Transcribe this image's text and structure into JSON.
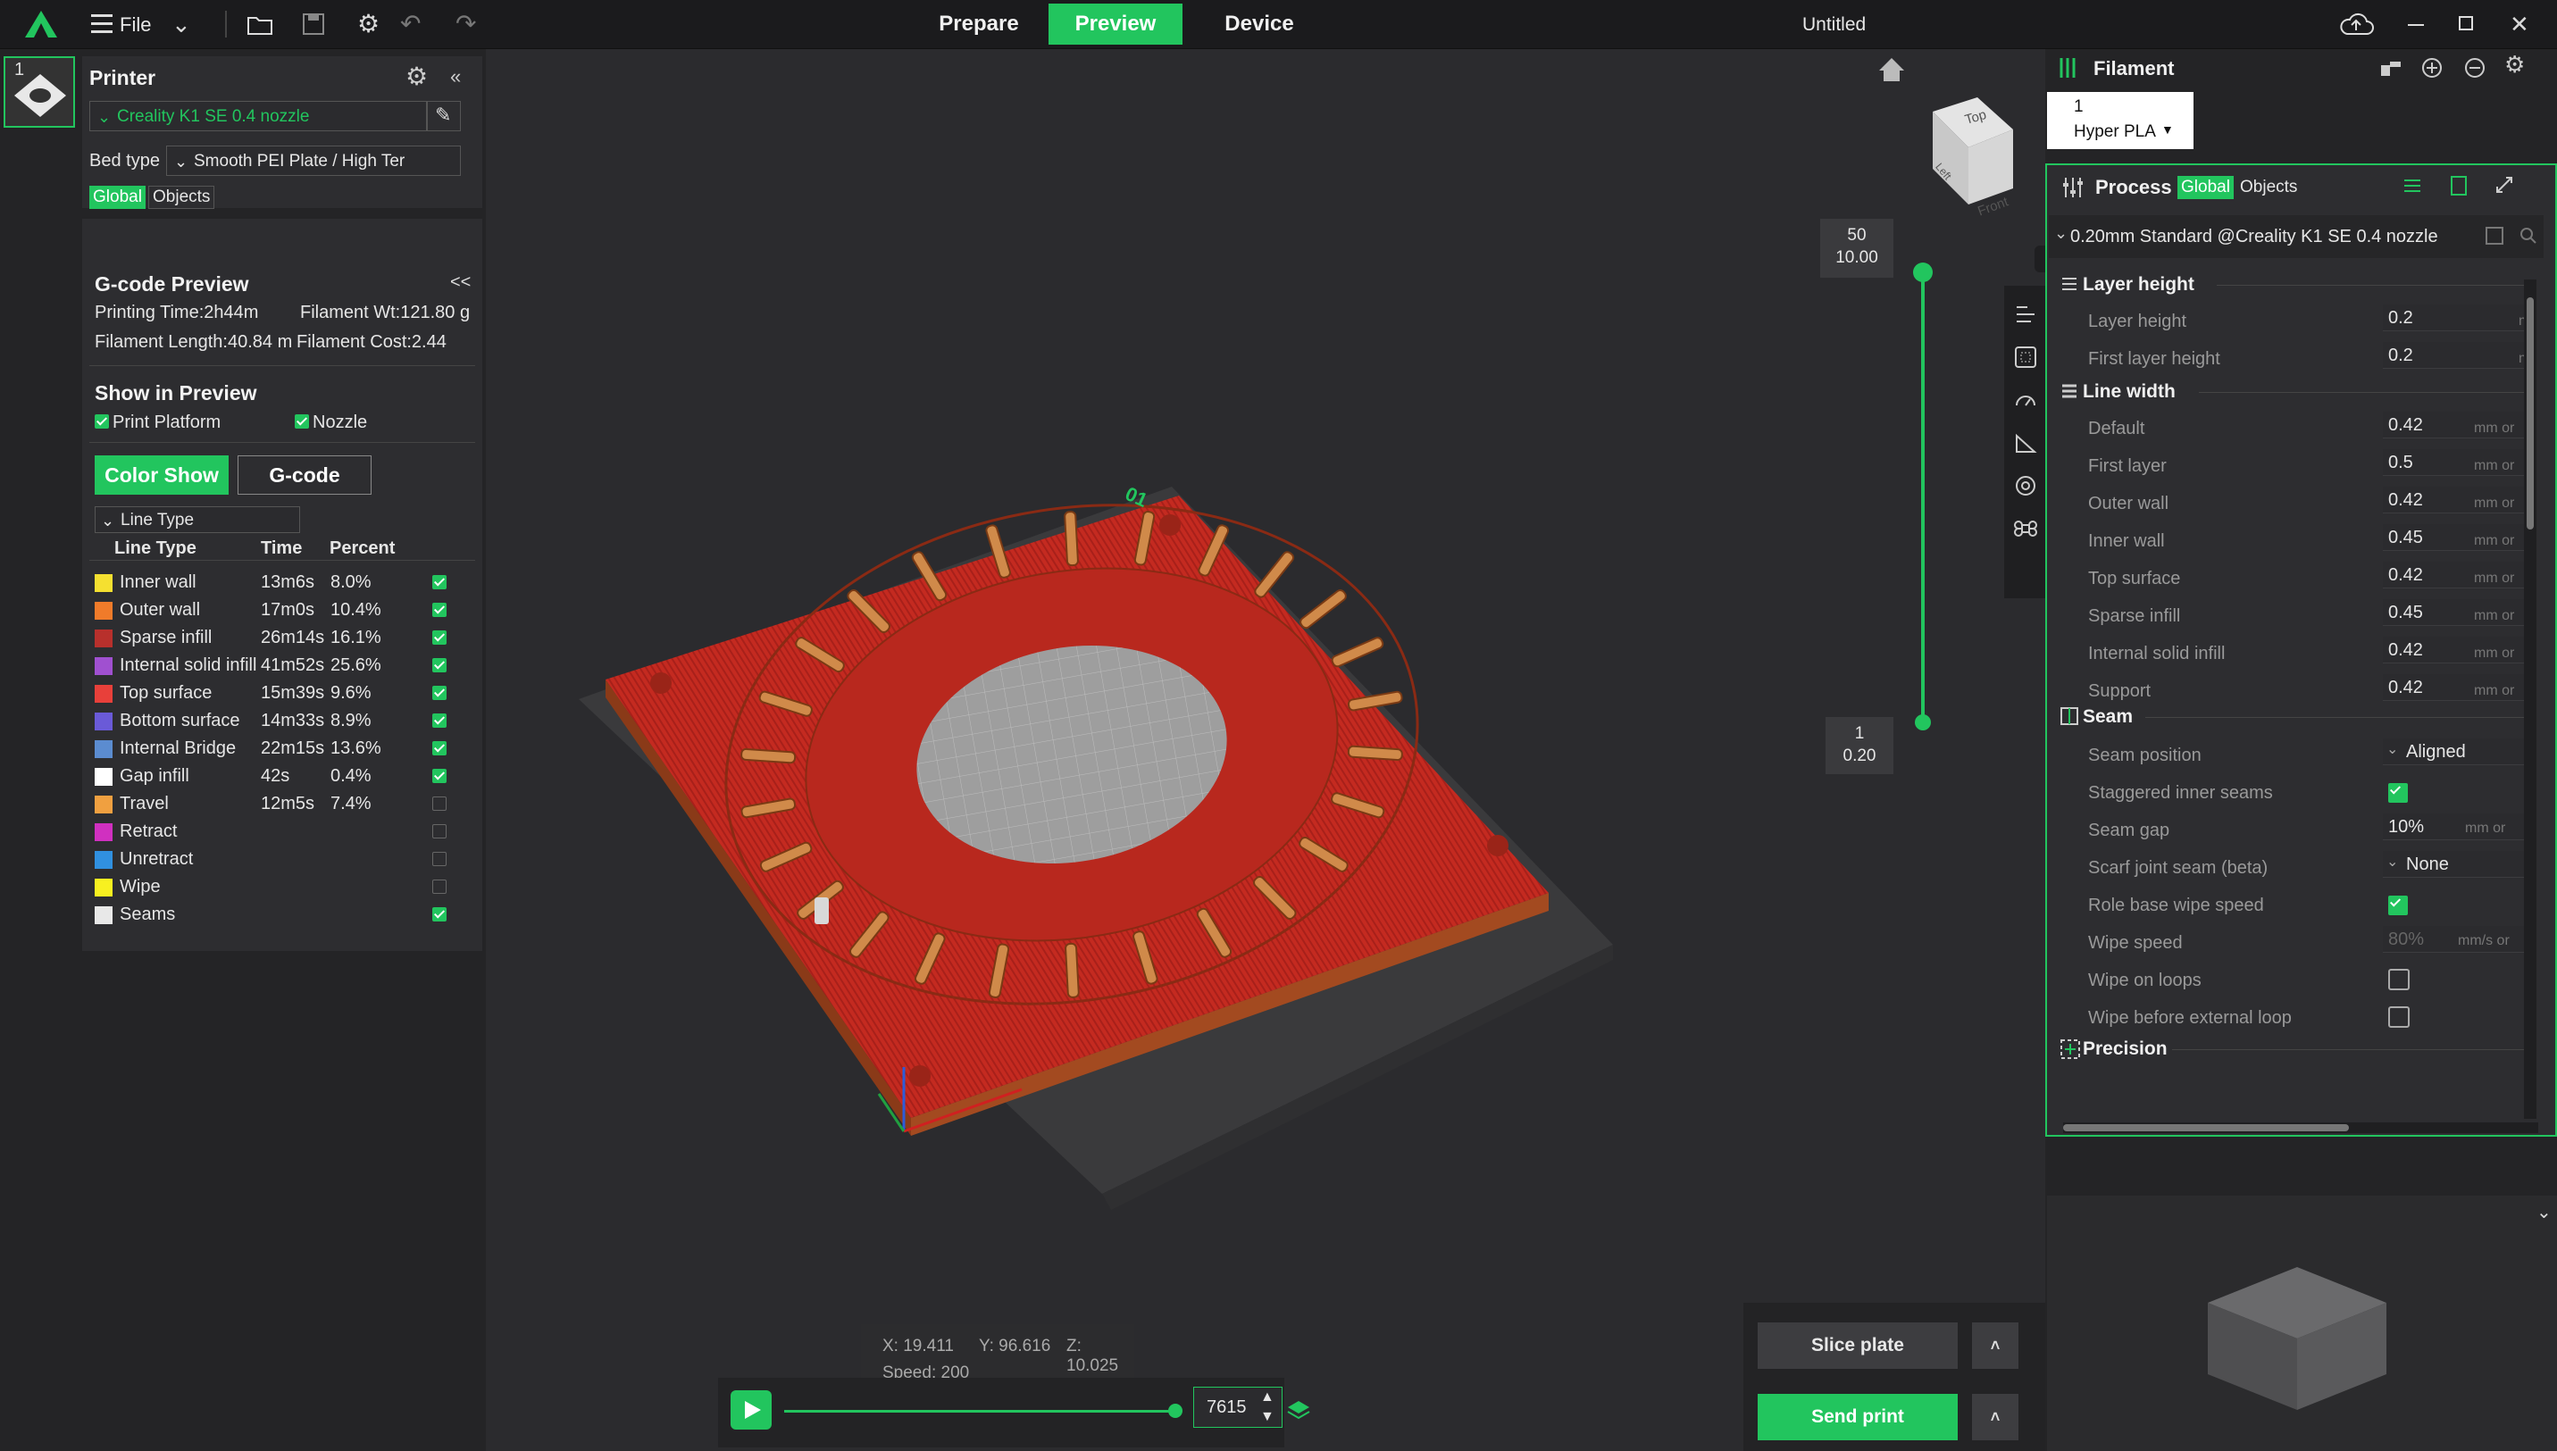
{
  "topbar": {
    "file_label": "File",
    "tabs": [
      {
        "label": "Prepare"
      },
      {
        "label": "Preview"
      },
      {
        "label": "Device"
      }
    ],
    "title": "Untitled"
  },
  "printer": {
    "header": "Printer",
    "printer_name": "Creality K1 SE 0.4 nozzle",
    "bed_type_label": "Bed type",
    "bed_type_value": "Smooth PEI Plate / High Ter",
    "global_label": "Global",
    "objects_label": "Objects",
    "plate_number": "1"
  },
  "gcode": {
    "header": "G-code Preview",
    "collapse": "<<",
    "printing_time": "Printing Time:2h44m",
    "filament_wt": "Filament Wt:121.80 g",
    "filament_length": "Filament Length:40.84 m",
    "filament_cost": "Filament Cost:2.44"
  },
  "show_preview": {
    "header": "Show in Preview",
    "print_platform": "Print Platform",
    "nozzle": "Nozzle",
    "color_show": "Color Show",
    "gcode_btn": "G-code",
    "line_type_select": "Line Type",
    "columns": [
      "Line Type",
      "Time",
      "Percent"
    ],
    "rows": [
      {
        "name": "Inner wall",
        "time": "13m6s",
        "percent": "8.0%",
        "color": "#f5e030",
        "checked": true
      },
      {
        "name": "Outer wall",
        "time": "17m0s",
        "percent": "10.4%",
        "color": "#f07b2a",
        "checked": true
      },
      {
        "name": "Sparse infill",
        "time": "26m14s",
        "percent": "16.1%",
        "color": "#b8302c",
        "checked": true
      },
      {
        "name": "Internal solid infill",
        "time": "41m52s",
        "percent": "25.6%",
        "color": "#a050d0",
        "checked": true
      },
      {
        "name": "Top surface",
        "time": "15m39s",
        "percent": "9.6%",
        "color": "#e8403a",
        "checked": true
      },
      {
        "name": "Bottom surface",
        "time": "14m33s",
        "percent": "8.9%",
        "color": "#6a5ad8",
        "checked": true
      },
      {
        "name": "Internal Bridge",
        "time": "22m15s",
        "percent": "13.6%",
        "color": "#5b8cd0",
        "checked": true
      },
      {
        "name": "Gap infill",
        "time": "42s",
        "percent": "0.4%",
        "color": "#ffffff",
        "checked": true
      },
      {
        "name": "Travel",
        "time": "12m5s",
        "percent": "7.4%",
        "color": "#f0a040",
        "checked": false
      },
      {
        "name": "Retract",
        "time": "",
        "percent": "",
        "color": "#d030c0",
        "checked": false
      },
      {
        "name": "Unretract",
        "time": "",
        "percent": "",
        "color": "#3090e0",
        "checked": false
      },
      {
        "name": "Wipe",
        "time": "",
        "percent": "",
        "color": "#f8f020",
        "checked": false
      },
      {
        "name": "Seams",
        "time": "",
        "percent": "",
        "color": "#e8e8e8",
        "checked": true
      }
    ]
  },
  "viewport": {
    "plate_label": "01",
    "cube_top": "Top",
    "cube_front": "Front",
    "cube_left": "Left",
    "slider_top_layer": "50",
    "slider_top_height": "10.00",
    "slider_bottom_layer": "1",
    "slider_bottom_height": "0.20",
    "coords_x": "X: 19.411",
    "coords_y": "Y: 96.616",
    "coords_z": "Z: 10.025",
    "speed": "Speed: 200",
    "move_value": "7615",
    "slice_plate": "Slice plate",
    "send_print": "Send print"
  },
  "filament": {
    "header": "Filament",
    "slot_number": "1",
    "slot_name": "Hyper PLA"
  },
  "process": {
    "header": "Process",
    "global_label": "Global",
    "objects_label": "Objects",
    "preset": "0.20mm Standard @Creality K1 SE 0.4 nozzle",
    "sections": {
      "layer_height": "Layer height",
      "line_width": "Line width",
      "seam": "Seam",
      "precision": "Precision"
    },
    "layer_height_rows": [
      {
        "label": "Layer height",
        "value": "0.2",
        "unit": "m"
      },
      {
        "label": "First layer height",
        "value": "0.2",
        "unit": "m"
      }
    ],
    "line_width_rows": [
      {
        "label": "Default",
        "value": "0.42",
        "unit": "mm or"
      },
      {
        "label": "First layer",
        "value": "0.5",
        "unit": "mm or"
      },
      {
        "label": "Outer wall",
        "value": "0.42",
        "unit": "mm or"
      },
      {
        "label": "Inner wall",
        "value": "0.45",
        "unit": "mm or"
      },
      {
        "label": "Top surface",
        "value": "0.42",
        "unit": "mm or"
      },
      {
        "label": "Sparse infill",
        "value": "0.45",
        "unit": "mm or"
      },
      {
        "label": "Internal solid infill",
        "value": "0.42",
        "unit": "mm or"
      },
      {
        "label": "Support",
        "value": "0.42",
        "unit": "mm or"
      }
    ],
    "seam_position_label": "Seam position",
    "seam_position_value": "Aligned",
    "staggered_label": "Staggered inner seams",
    "seam_gap_label": "Seam gap",
    "seam_gap_value": "10%",
    "seam_gap_unit": "mm or",
    "scarf_label": "Scarf joint seam (beta)",
    "scarf_value": "None",
    "role_wipe_label": "Role base wipe speed",
    "wipe_speed_label": "Wipe speed",
    "wipe_speed_value": "80%",
    "wipe_speed_unit": "mm/s or",
    "wipe_loops_label": "Wipe on loops",
    "wipe_before_label": "Wipe before external loop"
  },
  "colors": {
    "accent": "#22c55e",
    "model": "#c8281e"
  }
}
